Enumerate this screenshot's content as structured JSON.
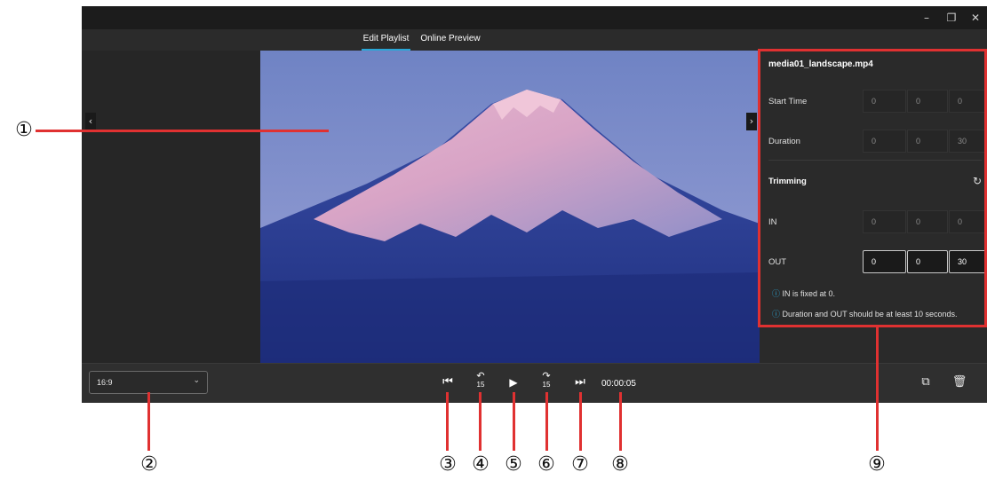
{
  "window": {
    "minimize_icon": "minimize-icon",
    "minimize": "–",
    "restore_icon": "restore-icon",
    "restore": "❐",
    "close_icon": "close-icon",
    "close": "✕"
  },
  "tabs": [
    {
      "label": "Edit Playlist",
      "active": true
    },
    {
      "label": "Online Preview",
      "active": false
    }
  ],
  "preview": {
    "prev_icon": "chevron-left-icon",
    "prev": "‹",
    "next_icon": "chevron-right-icon",
    "next": "›"
  },
  "panel": {
    "file_name": "media01_landscape.mp4",
    "start_time": {
      "label": "Start Time",
      "values": [
        "0",
        "0",
        "0"
      ]
    },
    "duration": {
      "label": "Duration",
      "values": [
        "0",
        "0",
        "30"
      ]
    },
    "trimming": {
      "label": "Trimming",
      "reset_icon": "reset-icon",
      "reset": "↻"
    },
    "in": {
      "label": "IN",
      "values": [
        "0",
        "0",
        "0"
      ]
    },
    "out": {
      "label": "OUT",
      "values": [
        "0",
        "0",
        "30"
      ]
    },
    "notes": [
      {
        "icon": "info-icon",
        "glyph": "ⓘ",
        "text": "IN is fixed at 0."
      },
      {
        "icon": "info-icon",
        "glyph": "ⓘ",
        "text": "Duration and OUT should be at least 10 seconds."
      }
    ]
  },
  "controls": {
    "aspect_ratio": "16:9",
    "aspect_chevron": "⌄",
    "skip_start": "⏮",
    "back_15_arc": "↶",
    "back_15_num": "15",
    "play": "▶",
    "forward_15_arc": "↷",
    "forward_15_num": "15",
    "skip_end": "⏭",
    "timecode": "00:00:05",
    "copy_icon": "copy-icon",
    "copy": "⧉",
    "delete_icon": "trash-icon",
    "delete": "🗑"
  },
  "callouts": [
    "①",
    "②",
    "③",
    "④",
    "⑤",
    "⑥",
    "⑦",
    "⑧",
    "⑨"
  ],
  "colors": {
    "accent": "#2aa7d6",
    "annotation": "#e03131",
    "background": "#1f1f1f"
  }
}
